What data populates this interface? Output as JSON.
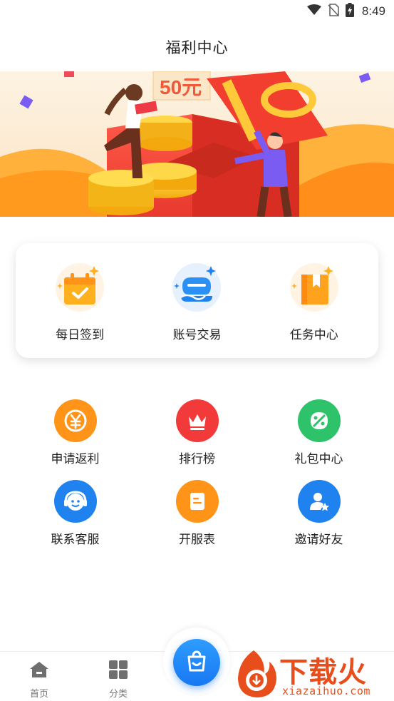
{
  "status_bar": {
    "time": "8:49",
    "icons": [
      "wifi-icon",
      "no-sim-icon",
      "battery-charging-icon"
    ]
  },
  "header": {
    "title": "福利中心"
  },
  "banner": {
    "coupon_text": "50元"
  },
  "quick_actions": [
    {
      "label": "每日签到",
      "icon": "calendar-check-icon"
    },
    {
      "label": "账号交易",
      "icon": "game-controller-icon"
    },
    {
      "label": "任务中心",
      "icon": "bookmark-task-icon"
    }
  ],
  "grid": {
    "row1": [
      {
        "label": "申请返利",
        "icon": "yen-coin-icon",
        "color": "#ff9418"
      },
      {
        "label": "排行榜",
        "icon": "crown-icon",
        "color": "#f23a3a"
      },
      {
        "label": "礼包中心",
        "icon": "gift-tag-icon",
        "color": "#2ec26a"
      }
    ],
    "row2": [
      {
        "label": "联系客服",
        "icon": "headset-icon",
        "color": "#1f82ee"
      },
      {
        "label": "开服表",
        "icon": "document-icon",
        "color": "#ff9418"
      },
      {
        "label": "邀请好友",
        "icon": "user-star-icon",
        "color": "#1f82ee"
      }
    ]
  },
  "bottom_nav": {
    "items": [
      {
        "label": "首页",
        "icon": "home-icon"
      },
      {
        "label": "分类",
        "icon": "grid-icon"
      }
    ],
    "fab_icon": "shopping-bag-icon"
  },
  "watermark": {
    "brand": "下载火",
    "url": "xiazaihuo.com"
  },
  "colors": {
    "accent_blue": "#1877f2",
    "orange": "#ff9418",
    "red": "#f23a3a",
    "green": "#2ec26a",
    "watermark": "#e84e1b"
  }
}
